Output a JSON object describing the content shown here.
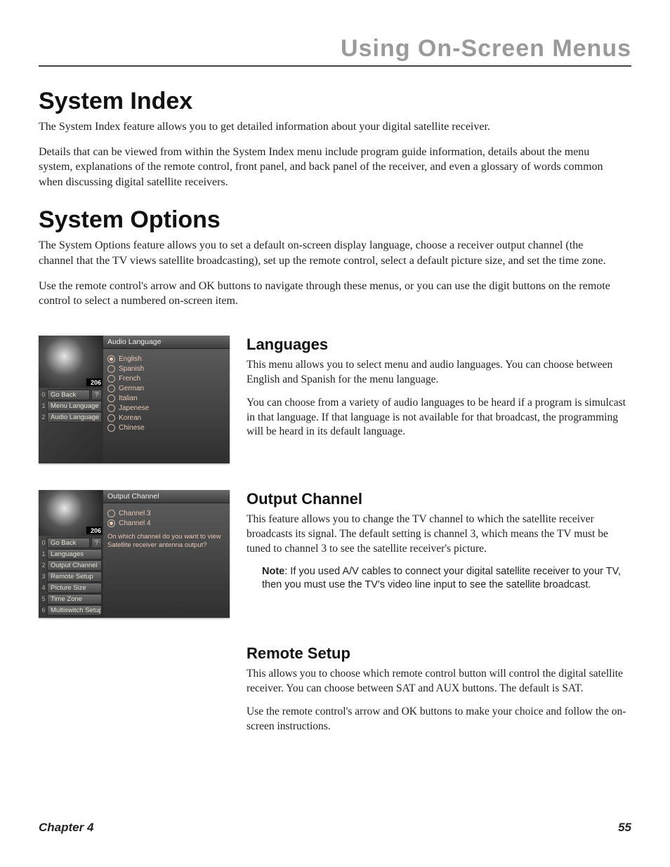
{
  "header": {
    "title": "Using On-Screen Menus"
  },
  "section1": {
    "heading": "System Index",
    "p1": "The System Index feature allows you to get detailed information about your digital satellite receiver.",
    "p2": "Details that can be viewed from within the System Index menu include program guide information, details about the menu system, explanations of the remote control, front panel, and back panel of the receiver, and even a glossary of words common when discussing digital satellite receivers."
  },
  "section2": {
    "heading": "System Options",
    "p1": "The System Options feature allows you to set a default on-screen display language, choose a receiver output channel (the channel that the TV views satellite broadcasting), set up the remote control, select a default picture size, and set the time zone.",
    "p2": "Use the remote control's arrow and OK buttons to navigate through these menus, or you can use the digit buttons on the remote control to select a numbered on-screen item."
  },
  "languages": {
    "heading": "Languages",
    "p1": "This menu allows you to select menu and audio languages. You can choose between English and Spanish for the menu language.",
    "p2": "You can choose from a variety of audio languages to be heard if a program is simulcast in that language. If that language is not available for that broadcast, the programming will be heard in its default language."
  },
  "output": {
    "heading": "Output Channel",
    "p1": "This feature allows you to change the TV channel to which the satellite receiver broadcasts its signal. The default setting is channel 3, which means the TV must be tuned to channel 3 to see the satellite receiver's picture.",
    "noteLabel": "Note",
    "note": ": If you used A/V cables to connect your digital satellite receiver to your TV, then you must use the TV's video line input to see the satellite broadcast."
  },
  "remote": {
    "heading": "Remote Setup",
    "p1": "This allows you to choose which remote control button will control the digital satellite receiver. You can choose between SAT and AUX buttons. The default is SAT.",
    "p2": "Use the remote control's arrow and OK buttons to make your choice and follow the on-screen instructions."
  },
  "footer": {
    "chapter": "Chapter 4",
    "page": "55"
  },
  "shot1": {
    "channel": "206",
    "panelTitle": "Audio Language",
    "leftItems": [
      {
        "num": "0",
        "label": "Go Back",
        "help": "?"
      },
      {
        "num": "1",
        "label": "Menu Language"
      },
      {
        "num": "2",
        "label": "Audio Language"
      }
    ],
    "options": [
      {
        "label": "English",
        "selected": true
      },
      {
        "label": "Spanish",
        "selected": false
      },
      {
        "label": "French",
        "selected": false
      },
      {
        "label": "German",
        "selected": false
      },
      {
        "label": "Italian",
        "selected": false
      },
      {
        "label": "Japenese",
        "selected": false
      },
      {
        "label": "Korean",
        "selected": false
      },
      {
        "label": "Chinese",
        "selected": false
      }
    ]
  },
  "shot2": {
    "channel": "206",
    "panelTitle": "Output Channel",
    "leftItems": [
      {
        "num": "0",
        "label": "Go Back",
        "help": "?"
      },
      {
        "num": "1",
        "label": "Languages"
      },
      {
        "num": "2",
        "label": "Output Channel"
      },
      {
        "num": "3",
        "label": "Remote Setup"
      },
      {
        "num": "4",
        "label": "Picture Size"
      },
      {
        "num": "5",
        "label": "Time Zone"
      },
      {
        "num": "6",
        "label": "Multiswitch Setup"
      }
    ],
    "options": [
      {
        "label": "Channel 3",
        "selected": false
      },
      {
        "label": "Channel 4",
        "selected": true
      }
    ],
    "hint": "On which channel do you want to view Satellite receiver antenna output?"
  }
}
